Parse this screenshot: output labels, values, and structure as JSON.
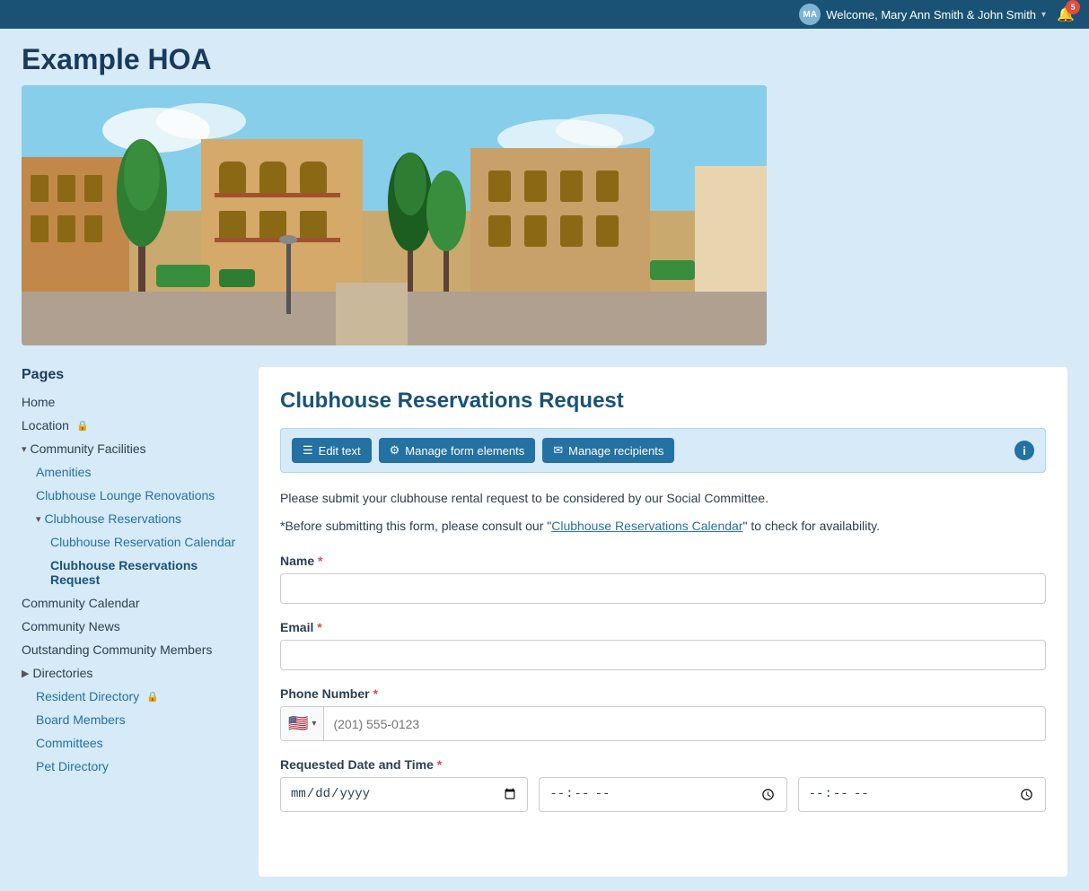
{
  "topbar": {
    "user_label": "Welcome, Mary Ann Smith & John Smith",
    "chevron": "▾",
    "notification_count": "5"
  },
  "header": {
    "site_title": "Example HOA"
  },
  "sidebar": {
    "section_title": "Pages",
    "items": [
      {
        "id": "home",
        "label": "Home",
        "level": 0,
        "icon": null,
        "lock": false
      },
      {
        "id": "location",
        "label": "Location",
        "level": 0,
        "icon": null,
        "lock": true
      },
      {
        "id": "community-facilities",
        "label": "Community Facilities",
        "level": 0,
        "icon": "chevron-down",
        "lock": false
      },
      {
        "id": "amenities",
        "label": "Amenities",
        "level": 1,
        "icon": null,
        "lock": false
      },
      {
        "id": "clubhouse-lounge-renovations",
        "label": "Clubhouse Lounge Renovations",
        "level": 1,
        "icon": null,
        "lock": false
      },
      {
        "id": "clubhouse-reservations",
        "label": "Clubhouse Reservations",
        "level": 1,
        "icon": "chevron-down",
        "lock": false
      },
      {
        "id": "clubhouse-reservation-calendar",
        "label": "Clubhouse Reservation Calendar",
        "level": 2,
        "icon": null,
        "lock": false
      },
      {
        "id": "clubhouse-reservations-request",
        "label": "Clubhouse Reservations Request",
        "level": 2,
        "icon": null,
        "lock": false,
        "active": true
      },
      {
        "id": "community-calendar",
        "label": "Community Calendar",
        "level": 0,
        "icon": null,
        "lock": false
      },
      {
        "id": "community-news",
        "label": "Community News",
        "level": 0,
        "icon": null,
        "lock": false
      },
      {
        "id": "outstanding-community-members",
        "label": "Outstanding Community Members",
        "level": 0,
        "icon": null,
        "lock": false
      },
      {
        "id": "directories",
        "label": "Directories",
        "level": 0,
        "icon": "chevron-right",
        "lock": false
      },
      {
        "id": "resident-directory",
        "label": "Resident Directory",
        "level": 1,
        "icon": null,
        "lock": true
      },
      {
        "id": "board-members",
        "label": "Board Members",
        "level": 1,
        "icon": null,
        "lock": false
      },
      {
        "id": "committees",
        "label": "Committees",
        "level": 1,
        "icon": null,
        "lock": false
      },
      {
        "id": "pet-directory",
        "label": "Pet Directory",
        "level": 1,
        "icon": null,
        "lock": false
      }
    ]
  },
  "content": {
    "page_title": "Clubhouse Reservations Request",
    "toolbar": {
      "edit_text_label": "Edit text",
      "manage_form_label": "Manage form elements",
      "manage_recipients_label": "Manage recipients",
      "info_icon_label": "i"
    },
    "form": {
      "description": "Please submit your clubhouse rental request to be considered by our Social Committee.",
      "note_prefix": "*Before submitting this form, please consult our \"",
      "note_link": "Clubhouse Reservations Calendar",
      "note_suffix": "\" to check for availability.",
      "fields": [
        {
          "id": "name",
          "label": "Name",
          "required": true,
          "type": "text",
          "placeholder": ""
        },
        {
          "id": "email",
          "label": "Email",
          "required": true,
          "type": "text",
          "placeholder": ""
        },
        {
          "id": "phone",
          "label": "Phone Number",
          "required": true,
          "type": "phone",
          "placeholder": "(201) 555-0123"
        },
        {
          "id": "requested-date",
          "label": "Requested Date and Time",
          "required": true,
          "type": "date-row"
        }
      ],
      "phone_flag": "🇺🇸",
      "phone_dropdown": "▾"
    }
  }
}
